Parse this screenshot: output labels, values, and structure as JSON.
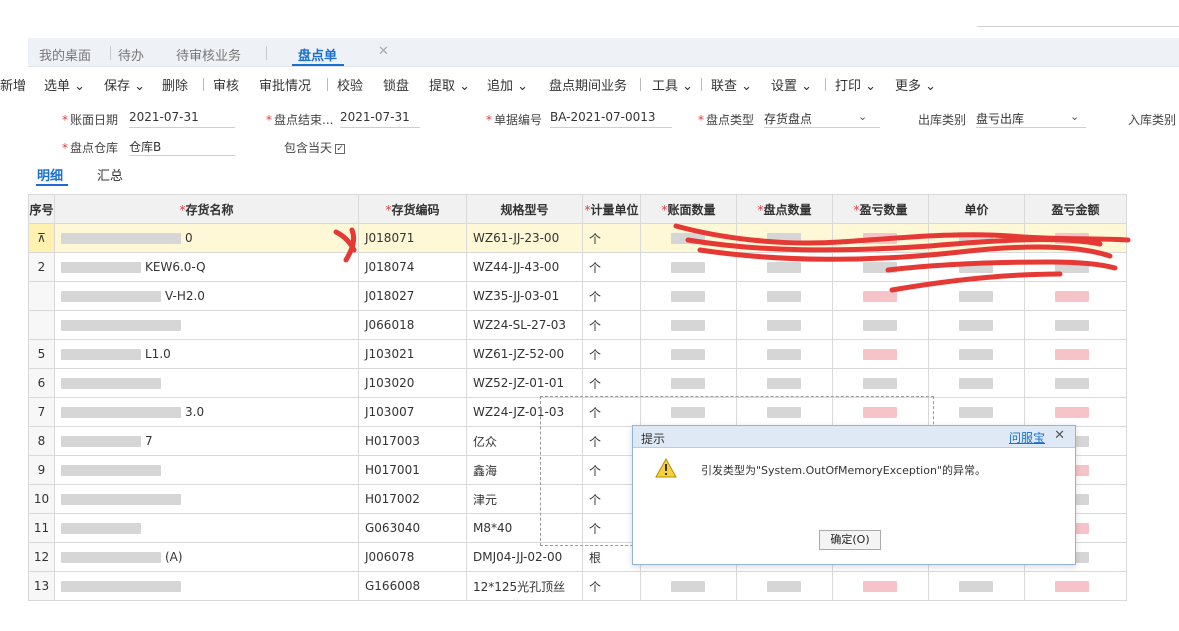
{
  "tabs": [
    {
      "label": "我的桌面"
    },
    {
      "label": "待办"
    },
    {
      "label": "待审核业务"
    },
    {
      "label": "盘点单"
    }
  ],
  "toolbar": {
    "items": [
      "新增",
      "选单",
      "保存",
      "删除",
      "审核",
      "审批情况",
      "校验",
      "锁盘",
      "提取",
      "追加",
      "盘点期间业务",
      "工具",
      "联查",
      "设置",
      "打印",
      "更多"
    ]
  },
  "form": {
    "account_date_label": "账面日期",
    "account_date": "2021-07-31",
    "end_date_label": "盘点结束...",
    "end_date": "2021-07-31",
    "doc_no_label": "单据编号",
    "doc_no": "BA-2021-07-0013",
    "check_type_label": "盘点类型",
    "check_type": "存货盘点",
    "out_type_label": "出库类别",
    "out_type": "盘亏出库",
    "in_type_label": "入库类别",
    "warehouse_label": "盘点仓库",
    "warehouse": "仓库B",
    "include_today_label": "包含当天",
    "include_today_mark": "✓"
  },
  "subtabs": [
    {
      "label": "明细"
    },
    {
      "label": "汇总"
    }
  ],
  "columns": [
    "序号",
    "存货名称",
    "存货编码",
    "规格型号",
    "计量单位",
    "账面数量",
    "盘点数量",
    "盈亏数量",
    "单价",
    "盈亏金额"
  ],
  "rows": [
    {
      "no": "",
      "name": "0",
      "code": "J018071",
      "spec": "WZ61-JJ-23-00",
      "unit": "个"
    },
    {
      "no": "2",
      "name": "KEW6.0-Q",
      "code": "J018074",
      "spec": "WZ44-JJ-43-00",
      "unit": "个"
    },
    {
      "no": "",
      "name": "V-H2.0",
      "code": "J018027",
      "spec": "WZ35-JJ-03-01",
      "unit": "个"
    },
    {
      "no": "",
      "name": "",
      "code": "J066018",
      "spec": "WZ24-SL-27-03",
      "unit": "个"
    },
    {
      "no": "5",
      "name": "L1.0",
      "code": "J103021",
      "spec": "WZ61-JZ-52-00",
      "unit": "个"
    },
    {
      "no": "6",
      "name": "",
      "code": "J103020",
      "spec": "WZ52-JZ-01-01",
      "unit": "个"
    },
    {
      "no": "7",
      "name": "3.0",
      "code": "J103007",
      "spec": "WZ24-JZ-01-03",
      "unit": "个"
    },
    {
      "no": "8",
      "name": "7",
      "code": "H017003",
      "spec": "亿众",
      "unit": "个"
    },
    {
      "no": "9",
      "name": "",
      "code": "H017001",
      "spec": "鑫海",
      "unit": "个"
    },
    {
      "no": "10",
      "name": "",
      "code": "H017002",
      "spec": "津元",
      "unit": "个"
    },
    {
      "no": "11",
      "name": "",
      "code": "G063040",
      "spec": "M8*40",
      "unit": "个"
    },
    {
      "no": "12",
      "name": "(A)",
      "code": "J006078",
      "spec": "DMJ04-JJ-02-00",
      "unit": "根"
    },
    {
      "no": "13",
      "name": "",
      "code": "G166008",
      "spec": "12*125光孔顶丝",
      "unit": "个"
    }
  ],
  "dialog": {
    "title": "提示",
    "help": "问服宝",
    "close": "✕",
    "message": "引发类型为\"System.OutOfMemoryException\"的异常。",
    "ok_button": "确定(O)"
  },
  "colors": {
    "accent": "#1a6fd1",
    "required": "#e03c3c",
    "selected_row": "#fff8d6",
    "scribble": "#e53935"
  }
}
